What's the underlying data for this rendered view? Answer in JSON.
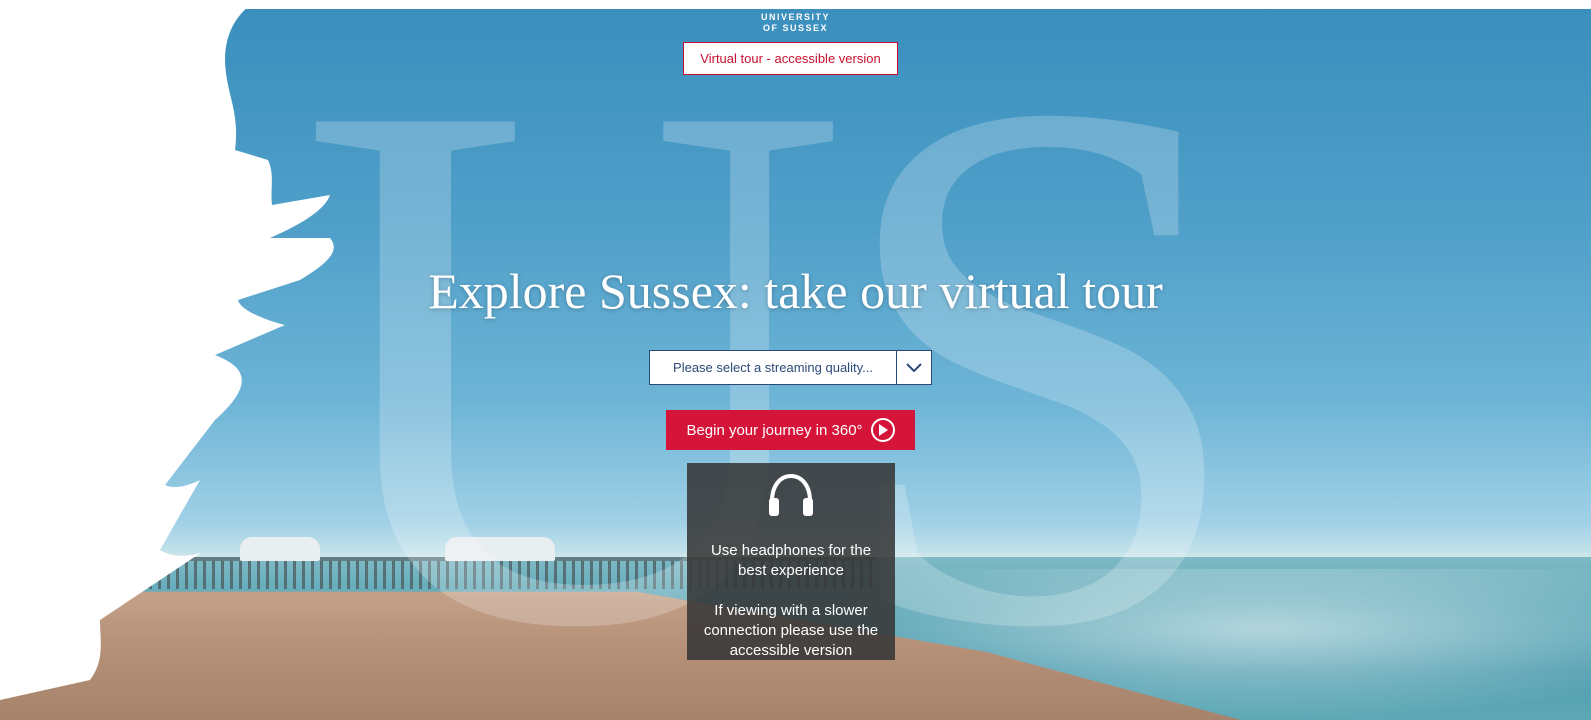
{
  "logo": {
    "line1": "UNIVERSITY",
    "line2": "OF SUSSEX"
  },
  "accessible_button": {
    "label": "Virtual tour - accessible version"
  },
  "hero": {
    "headline": "Explore Sussex: take our virtual tour",
    "watermark": "US",
    "quality_select": {
      "placeholder": "Please select a streaming quality..."
    },
    "begin_button": {
      "label": "Begin your journey in 360°"
    }
  },
  "info": {
    "headphones_tip": "Use headphones for the best experience",
    "connection_tip": "If viewing with a slower connection please use the accessible version"
  },
  "colors": {
    "accent_red": "#d5143a",
    "navy": "#2c4a78",
    "sky_blue": "#4f9fc9"
  },
  "icons": [
    "headphones-icon",
    "chevron-down-icon",
    "play-icon"
  ]
}
